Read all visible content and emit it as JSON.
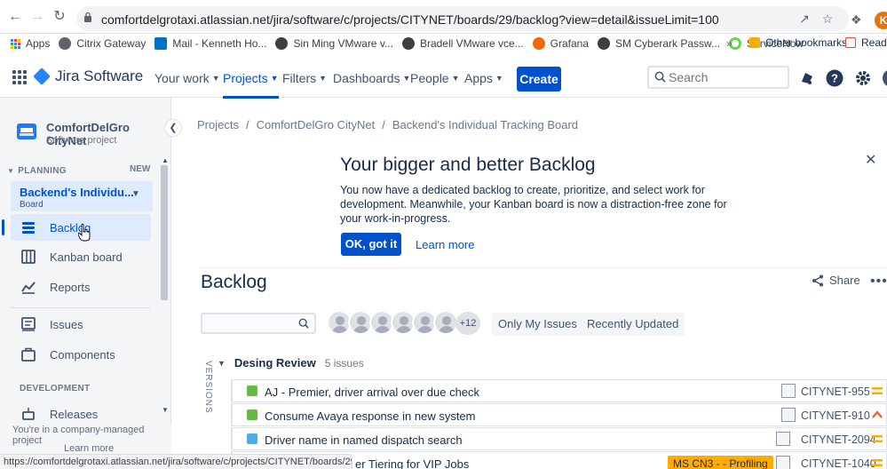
{
  "browser": {
    "url": "comfortdelgrotaxi.atlassian.net/jira/software/c/projects/CITYNET/boards/29/backlog?view=detail&issueLimit=100",
    "profile_initial": "K",
    "bookmarks": [
      {
        "label": "Apps",
        "color": "#4285f4"
      },
      {
        "label": "Citrix Gateway",
        "color": "#5f6368"
      },
      {
        "label": "Mail - Kenneth Ho...",
        "color": "#0072c6"
      },
      {
        "label": "Sin Ming VMware v...",
        "color": "#3c4043"
      },
      {
        "label": "Bradell VMware vce...",
        "color": "#3c4043"
      },
      {
        "label": "Grafana",
        "color": "#f46800"
      },
      {
        "label": "SM Cyberark Passw...",
        "color": "#3c4043"
      },
      {
        "label": "ServiceNow",
        "color": "#62d84e"
      }
    ],
    "bookmarks_more": "»",
    "other_bookmarks": "Other bookmarks",
    "reading_list": "Readi",
    "status_url": "https://comfortdelgrotaxi.atlassian.net/jira/software/c/projects/CITYNET/boards/29/backlog"
  },
  "topnav": {
    "product": "Jira Software",
    "items": [
      "Your work",
      "Projects",
      "Filters",
      "Dashboards",
      "People",
      "Apps"
    ],
    "active_item": "Projects",
    "create_label": "Create",
    "search_placeholder": "Search"
  },
  "sidebar": {
    "project_name": "ComfortDelGro CityNet",
    "project_type": "Software project",
    "planning_label": "PLANNING",
    "new_badge": "NEW",
    "board_name": "Backend's Individu...",
    "board_type": "Board",
    "planning_items": [
      "Backlog",
      "Kanban board",
      "Reports"
    ],
    "other_items": [
      "Issues",
      "Components"
    ],
    "development_label": "DEVELOPMENT",
    "development_items": [
      "Releases"
    ],
    "footer_text": "You're in a company-managed project",
    "footer_link": "Learn more"
  },
  "breadcrumb": [
    "Projects",
    "ComfortDelGro CityNet",
    "Backend's Individual Tracking Board"
  ],
  "banner": {
    "title": "Your bigger and better Backlog",
    "body": "You now have a dedicated backlog to create, prioritize, and select work for development. Meanwhile, your Kanban board is now a distraction-free zone for your work-in-progress.",
    "ok_label": "OK, got it",
    "learn_label": "Learn more"
  },
  "backlog": {
    "title": "Backlog",
    "share_label": "Share",
    "more_avatars": "+12",
    "quick_filters": [
      "Only My Issues",
      "Recently Updated"
    ],
    "versions_label": "VERSIONS",
    "sprint_name": "Desing Review",
    "sprint_count": "5 issues",
    "issues": [
      {
        "summary": "AJ - Premier, driver arrival over due check",
        "key": "CITYNET-955",
        "type": "story",
        "type_color": "#65ba43",
        "priority_color": "#ffab00",
        "epic": ""
      },
      {
        "summary": "Consume Avaya response in new system",
        "key": "CITYNET-910",
        "type": "story",
        "type_color": "#65ba43",
        "priority_color": "#ff5630",
        "epic": ""
      },
      {
        "summary": "Driver name in named dispatch search",
        "key": "CITYNET-2094",
        "type": "task",
        "type_color": "#4bade8",
        "priority_color": "#ffab00",
        "epic": ""
      },
      {
        "summary": "er Tiering for VIP Jobs",
        "key": "CITYNET-1040",
        "type": "story",
        "type_color": "#65ba43",
        "priority_color": "#ffab00",
        "epic": "MS CN3 - - Profiling"
      }
    ]
  },
  "colors": {
    "brand": "#0052cc",
    "selected_bg": "#deebff",
    "sidebar_bg": "#f4f5f7"
  }
}
